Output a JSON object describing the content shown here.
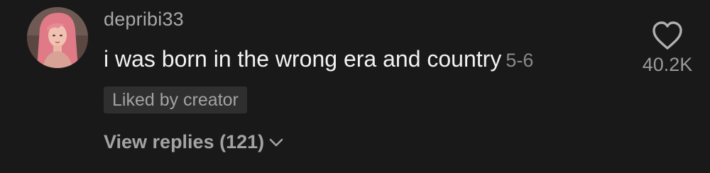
{
  "comment": {
    "username": "depribi33",
    "text": "i was born in the wrong era and country",
    "date": "5-6",
    "liked_by_creator_label": "Liked by creator",
    "view_replies_label": "View replies (121)",
    "like_count": "40.2K"
  },
  "icons": {
    "like": "heart-outline-icon",
    "expand": "chevron-down-icon"
  },
  "colors": {
    "background": "#191919",
    "username": "#a8a8a8",
    "comment_text": "#f2f2f2",
    "secondary": "#8a8a8a",
    "badge_bg": "#2f2f2f"
  }
}
